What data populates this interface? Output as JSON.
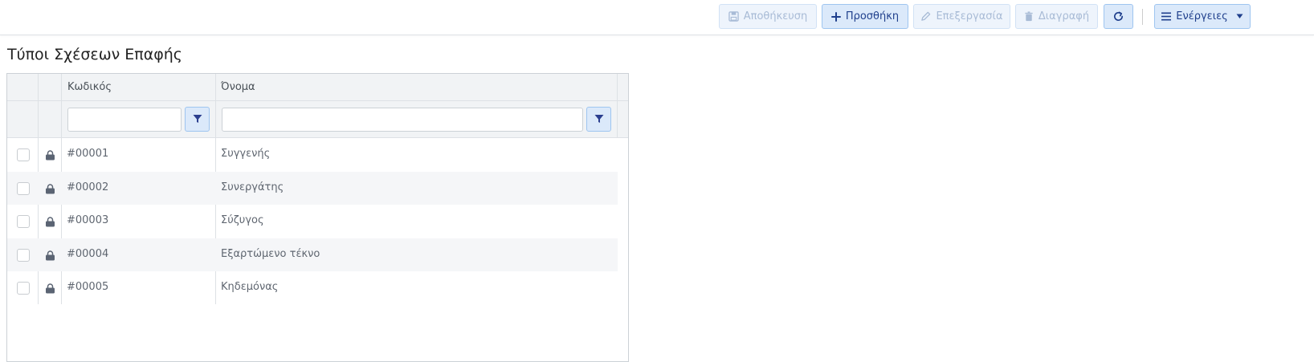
{
  "toolbar": {
    "save_label": "Αποθήκευση",
    "add_label": "Προσθήκη",
    "edit_label": "Επεξεργασία",
    "delete_label": "Διαγραφή",
    "actions_label": "Ενέργειες",
    "accent_color": "#1f3f8c"
  },
  "page": {
    "title": "Τύποι Σχέσεων Επαφής"
  },
  "grid": {
    "columns": [
      "Κωδικός",
      "Όνομα"
    ],
    "filters": {
      "code_value": "",
      "name_value": ""
    },
    "rows": [
      {
        "code": "#00001",
        "name": "Συγγενής"
      },
      {
        "code": "#00002",
        "name": "Συνεργάτης"
      },
      {
        "code": "#00003",
        "name": "Σύζυγος"
      },
      {
        "code": "#00004",
        "name": "Εξαρτώμενο τέκνο"
      },
      {
        "code": "#00005",
        "name": "Κηδεμόνας"
      }
    ]
  },
  "icons": {
    "save": "floppy-icon",
    "add": "plus-icon",
    "edit": "pencil-icon",
    "delete": "trash-icon",
    "refresh": "refresh-icon",
    "actions": "menu-icon",
    "filter": "filter-icon",
    "row_lock": "lock-icon"
  }
}
